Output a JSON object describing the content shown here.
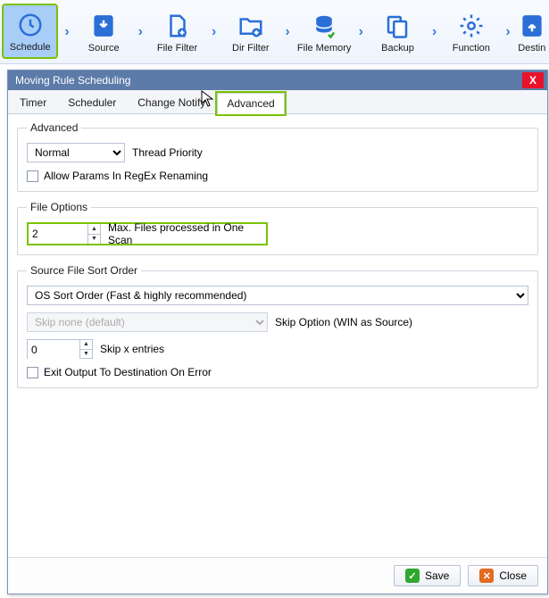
{
  "toolbar": {
    "items": [
      {
        "label": "Schedule",
        "icon": "clock-icon",
        "selected": true
      },
      {
        "label": "Source",
        "icon": "download-icon",
        "selected": false
      },
      {
        "label": "File Filter",
        "icon": "file-plus-icon",
        "selected": false
      },
      {
        "label": "Dir Filter",
        "icon": "folder-plus-icon",
        "selected": false
      },
      {
        "label": "File Memory",
        "icon": "database-icon",
        "selected": false
      },
      {
        "label": "Backup",
        "icon": "copy-icon",
        "selected": false
      },
      {
        "label": "Function",
        "icon": "gear-icon",
        "selected": false
      },
      {
        "label": "Destin",
        "icon": "upload-icon",
        "selected": false
      }
    ],
    "separator_glyph": "›"
  },
  "modal": {
    "title": "Moving Rule Scheduling",
    "close_glyph": "X",
    "tabs": [
      {
        "label": "Timer",
        "active": false
      },
      {
        "label": "Scheduler",
        "active": false
      },
      {
        "label": "Change Notify",
        "active": false
      },
      {
        "label": "Advanced",
        "active": true
      }
    ],
    "advanced": {
      "legend": "Advanced",
      "thread_priority": {
        "value": "Normal",
        "label": "Thread Priority"
      },
      "allow_params": {
        "checked": false,
        "label": "Allow Params In RegEx Renaming"
      }
    },
    "file_options": {
      "legend": "File Options",
      "max_files": {
        "value": "2",
        "label": "Max. Files processed in One Scan"
      }
    },
    "sort_order": {
      "legend": "Source File Sort Order",
      "order": {
        "value": "OS Sort Order (Fast & highly recommended)"
      },
      "skip_option": {
        "value": "Skip none (default)",
        "label": "Skip Option (WIN as Source)",
        "disabled": true
      },
      "skip_x": {
        "value": "0",
        "label": "Skip x entries"
      },
      "exit_output": {
        "checked": false,
        "label": "Exit Output To Destination On Error"
      }
    },
    "footer": {
      "save": "Save",
      "close": "Close"
    }
  }
}
